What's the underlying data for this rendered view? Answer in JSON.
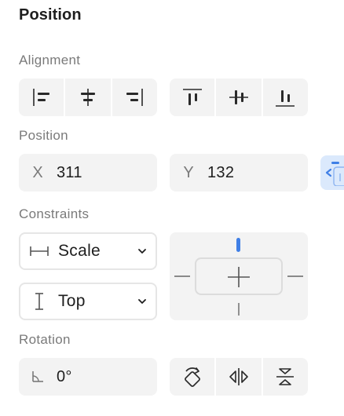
{
  "panel": {
    "title": "Position"
  },
  "alignment": {
    "label": "Alignment",
    "horizontal": [
      {
        "icon": "align-left-icon"
      },
      {
        "icon": "align-horizontal-center-icon"
      },
      {
        "icon": "align-right-icon"
      }
    ],
    "vertical": [
      {
        "icon": "align-top-icon"
      },
      {
        "icon": "align-vertical-center-icon"
      },
      {
        "icon": "align-bottom-icon"
      }
    ]
  },
  "position": {
    "label": "Position",
    "x_label": "X",
    "x_value": "311",
    "y_label": "Y",
    "y_value": "132"
  },
  "constraints": {
    "label": "Constraints",
    "horizontal": {
      "value": "Scale",
      "icon": "horizontal-constraint-icon"
    },
    "vertical": {
      "value": "Top",
      "icon": "vertical-constraint-icon"
    },
    "active_side": "top",
    "accent_color": "#3f7fe6"
  },
  "rotation": {
    "label": "Rotation",
    "value": "0°",
    "actions": [
      {
        "icon": "rotate-icon"
      },
      {
        "icon": "flip-horizontal-icon"
      },
      {
        "icon": "flip-vertical-icon"
      }
    ]
  }
}
